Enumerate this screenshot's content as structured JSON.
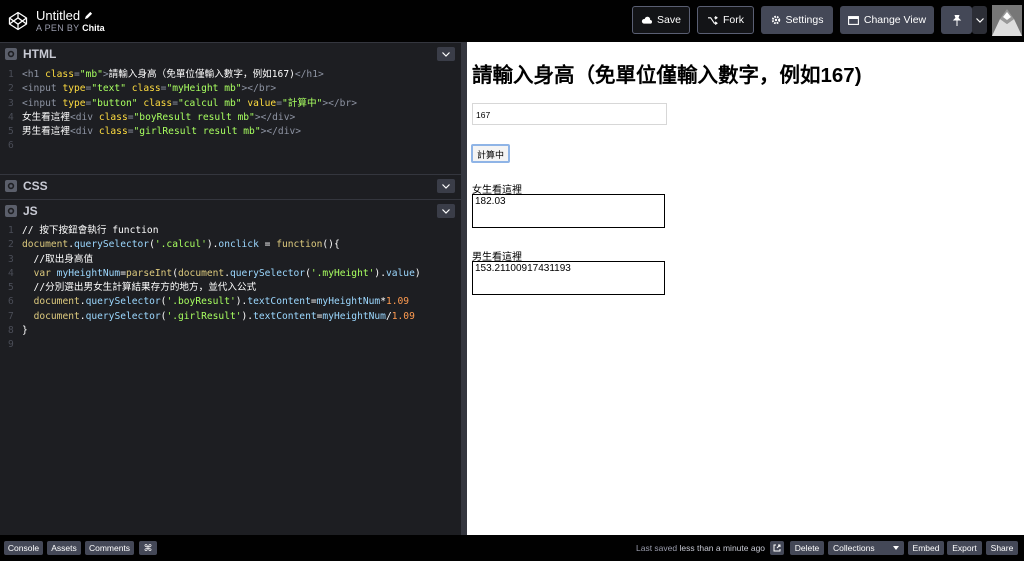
{
  "header": {
    "title": "Untitled",
    "by_prefix": "A PEN BY",
    "author": "Chita",
    "buttons": {
      "save": "Save",
      "fork": "Fork",
      "settings": "Settings",
      "change_view": "Change View"
    }
  },
  "panes": {
    "html": "HTML",
    "css": "CSS",
    "js": "JS"
  },
  "html_code": {
    "line_numbers": [
      "1",
      "2",
      "3",
      "4",
      "5",
      "6"
    ]
  },
  "js_code": {
    "line_numbers": [
      "1",
      "2",
      "3",
      "4",
      "5",
      "6",
      "7",
      "8",
      "9"
    ]
  },
  "preview": {
    "heading": "請輸入身高（免單位僅輸入數字，例如167)",
    "input_value": "167",
    "button_label": "計算中",
    "girl_label": "女生看這裡",
    "girl_result": "182.03",
    "boy_label": "男生看這裡",
    "boy_result": "153.21100917431193"
  },
  "footer": {
    "console": "Console",
    "assets": "Assets",
    "comments": "Comments",
    "saved_prefix": "Last saved",
    "saved_time": "less than a minute ago",
    "delete": "Delete",
    "collections": "Collections",
    "embed": "Embed",
    "export": "Export",
    "share": "Share"
  },
  "colors": {
    "topbar": "#010101",
    "editor_bg": "#1d1e22",
    "button": "#444857",
    "string": "#a8ff60",
    "attr": "#ffdd40"
  }
}
